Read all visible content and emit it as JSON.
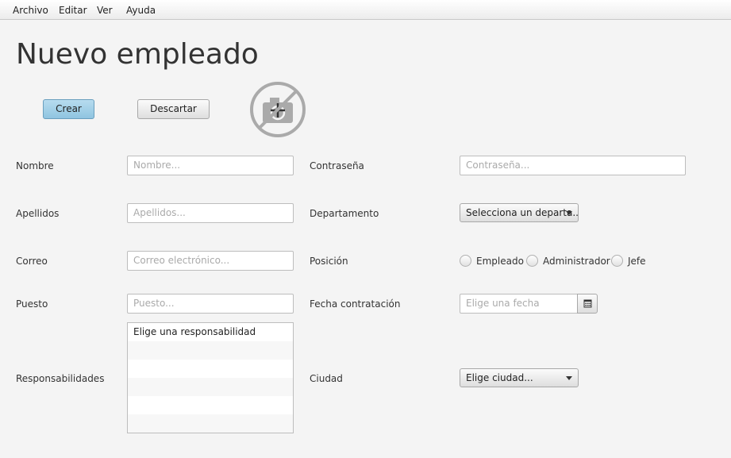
{
  "menu": {
    "items": [
      "Archivo",
      "Editar",
      "Ver",
      "Ayuda"
    ]
  },
  "page": {
    "title": "Nuevo empleado"
  },
  "actions": {
    "create_label": "Crear",
    "discard_label": "Descartar"
  },
  "form": {
    "nombre": {
      "label": "Nombre",
      "placeholder": "Nombre..."
    },
    "apellidos": {
      "label": "Apellidos",
      "placeholder": "Apellidos..."
    },
    "correo": {
      "label": "Correo",
      "placeholder": "Correo electrónico..."
    },
    "puesto": {
      "label": "Puesto",
      "placeholder": "Puesto..."
    },
    "responsabilidades": {
      "label": "Responsabilidades",
      "items": [
        "Elige una responsabilidad",
        "",
        "",
        "",
        "",
        ""
      ]
    },
    "contrasena": {
      "label": "Contraseña",
      "placeholder": "Contraseña..."
    },
    "departamento": {
      "label": "Departamento",
      "value": "Selecciona un departa..."
    },
    "posicion": {
      "label": "Posición",
      "options": [
        "Empleado",
        "Administrador",
        "Jefe"
      ],
      "selected": null
    },
    "fecha": {
      "label": "Fecha contratación",
      "placeholder": "Elige una fecha"
    },
    "ciudad": {
      "label": "Ciudad",
      "value": "Elige ciudad..."
    }
  },
  "icons": {
    "photo": "add-photo-disabled-icon",
    "calendar": "calendar-icon"
  }
}
